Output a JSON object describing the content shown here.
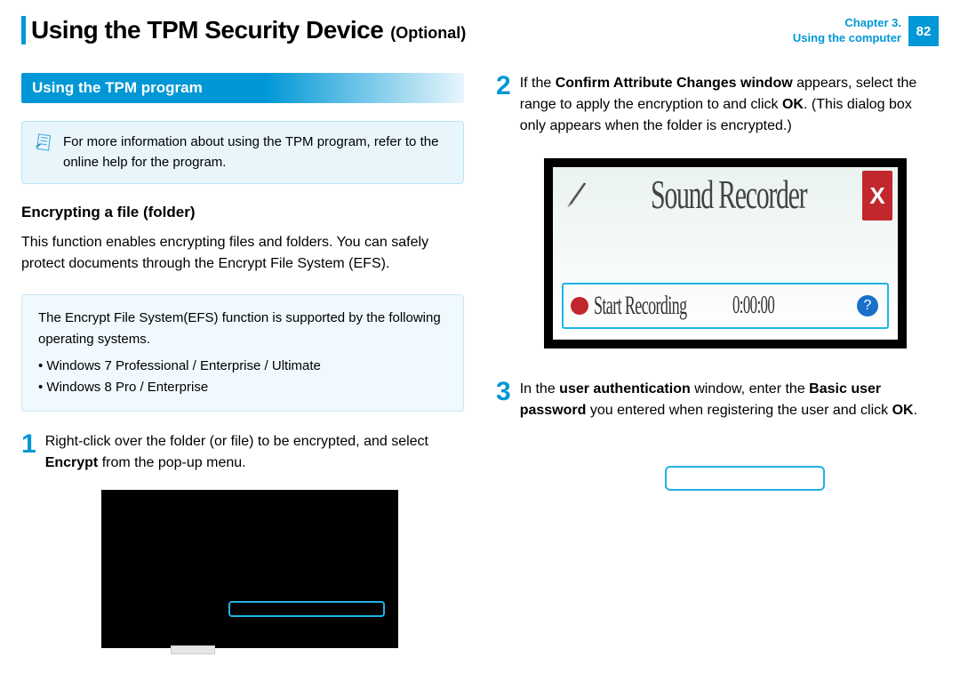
{
  "header": {
    "title": "Using the TPM Security Device",
    "subtitle": "(Optional)",
    "chapter_line1": "Chapter 3.",
    "chapter_line2": "Using the computer",
    "page_number": "82"
  },
  "left": {
    "section_head": "Using the TPM program",
    "info_text": "For more information about using the TPM program, refer to the online help for the program.",
    "subhead": "Encrypting a file (folder)",
    "intro": "This function enables encrypting files and folders. You can safely protect documents through the Encrypt File System (EFS).",
    "efs_box": {
      "lead": "The Encrypt File System(EFS) function is supported by the following operating systems.",
      "items": [
        "Windows 7 Professional / Enterprise / Ultimate",
        "Windows 8 Pro / Enterprise"
      ]
    },
    "step1": {
      "num": "1",
      "pre": "Right-click over the folder (or file) to be encrypted, and select ",
      "bold": "Encrypt",
      "post": " from the pop-up menu."
    }
  },
  "right": {
    "step2": {
      "num": "2",
      "pre": "If the ",
      "b1": "Confirm Attribute Changes window",
      "mid": " appears, select the range to apply the encryption to and click ",
      "b2": "OK",
      "post": ". (This dialog box only appears when the folder is encrypted.)"
    },
    "fig2": {
      "window_title": "Sound Recorder",
      "button_label": "Start Recording",
      "timer": "0:00:00",
      "close_glyph": "X",
      "help_glyph": "?"
    },
    "step3": {
      "num": "3",
      "pre": "In the ",
      "b1": "user authentication",
      "mid1": " window, enter the ",
      "b2": "Basic user password",
      "mid2": " you entered when registering the user and click ",
      "b3": "OK",
      "post": "."
    }
  }
}
